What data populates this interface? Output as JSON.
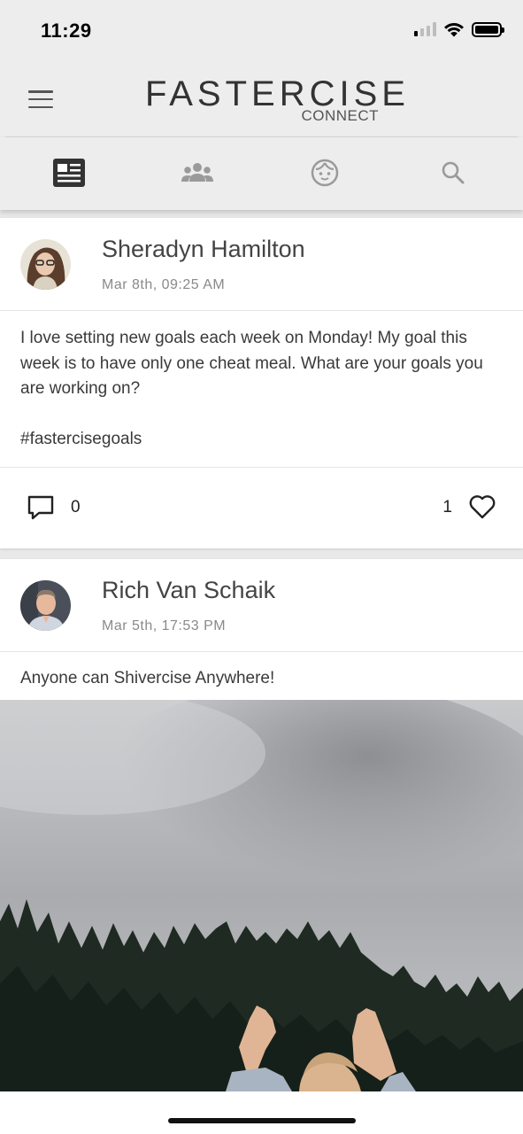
{
  "status_bar": {
    "time": "11:29",
    "signal_bars": 4,
    "signal_active": 1,
    "wifi": "wifi-icon",
    "battery_level": 1.0
  },
  "header": {
    "logo_main": "FASTERCISE",
    "logo_sub": "CONNECT",
    "menu_icon": "hamburger-menu-icon"
  },
  "tabs": [
    {
      "name": "feed",
      "icon": "newsfeed-icon",
      "active": true
    },
    {
      "name": "groups",
      "icon": "group-icon",
      "active": false
    },
    {
      "name": "profile",
      "icon": "face-icon",
      "active": false
    },
    {
      "name": "search",
      "icon": "search-icon",
      "active": false
    }
  ],
  "posts": [
    {
      "author": "Sheradyn Hamilton",
      "date": "Mar 8th, 09:25 AM",
      "text": "I love setting new goals each week on Monday! My goal this week is to have only one cheat meal. What are your goals you are working on?",
      "hashtag": "#fastercisegoals",
      "comments": "0",
      "likes": "1"
    },
    {
      "author": "Rich Van Schaik",
      "date": "Mar 5th, 17:53 PM",
      "text": "Anyone can Shivercise Anywhere!",
      "has_photo": true
    }
  ],
  "colors": {
    "header_bg": "#ededed",
    "active_tab": "#333333",
    "inactive_tab": "#9a9a9a",
    "card_bg": "#ffffff"
  }
}
